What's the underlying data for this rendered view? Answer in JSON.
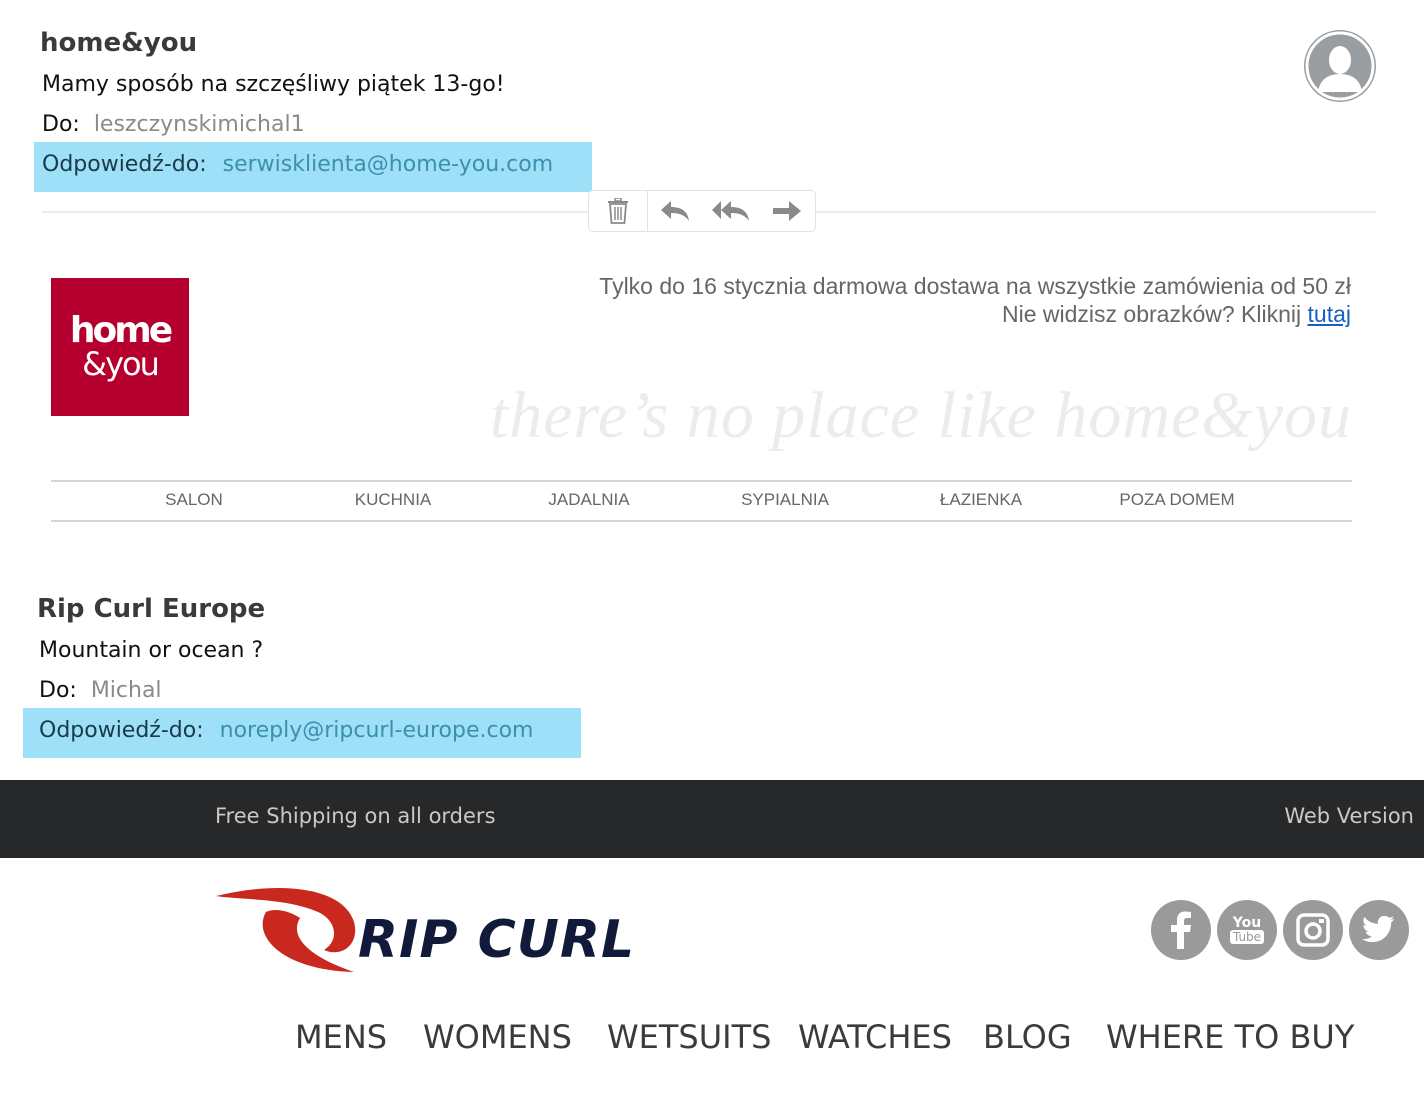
{
  "email1": {
    "sender": "home&you",
    "subject": "Mamy sposób na szczęśliwy piątek 13-go!",
    "to_label": "Do:",
    "to_value": "leszczynskimichal1",
    "reply_label": "Odpowiedź-do:",
    "reply_value": "serwisklienta@home-you.com"
  },
  "toolbar": {
    "icons": [
      "trash-icon",
      "reply-icon",
      "reply-all-icon",
      "forward-icon"
    ]
  },
  "homeyou": {
    "logo_line1": "home",
    "logo_line2": "&you",
    "promo_line1": "Tylko do 16 stycznia darmowa dostawa na wszystkie zamówienia od 50 zł",
    "promo_line2": "Nie widzisz obrazków? Kliknij ",
    "promo_link": "tutaj",
    "tagline": "there’s no place like home&you",
    "nav": [
      "SALON",
      "KUCHNIA",
      "JADALNIA",
      "SYPIALNIA",
      "ŁAZIENKA",
      "POZA DOMEM"
    ]
  },
  "email2": {
    "sender": "Rip Curl Europe",
    "subject": "Mountain or ocean ?",
    "to_label": "Do:",
    "to_value": "Michal",
    "reply_label": "Odpowiedź-do:",
    "reply_value": "noreply@ripcurl-europe.com"
  },
  "ripcurl": {
    "bar_left": "Free Shipping on all orders",
    "bar_right": "Web Version",
    "logo_text": "RIP CURL",
    "social": [
      "facebook-icon",
      "youtube-icon",
      "instagram-icon",
      "twitter-icon"
    ],
    "youtube_top": "You",
    "youtube_bottom": "Tube",
    "nav": [
      "MENS",
      "WOMENS",
      "WETSUITS",
      "WATCHES",
      "BLOG",
      "WHERE TO BUY"
    ]
  },
  "colors": {
    "highlight": "#9ee0f7",
    "homeyou_red": "#b5002f",
    "ripcurl_red": "#c8281e",
    "ripcurl_navy": "#111a3a",
    "dark_bar": "#27282a"
  }
}
